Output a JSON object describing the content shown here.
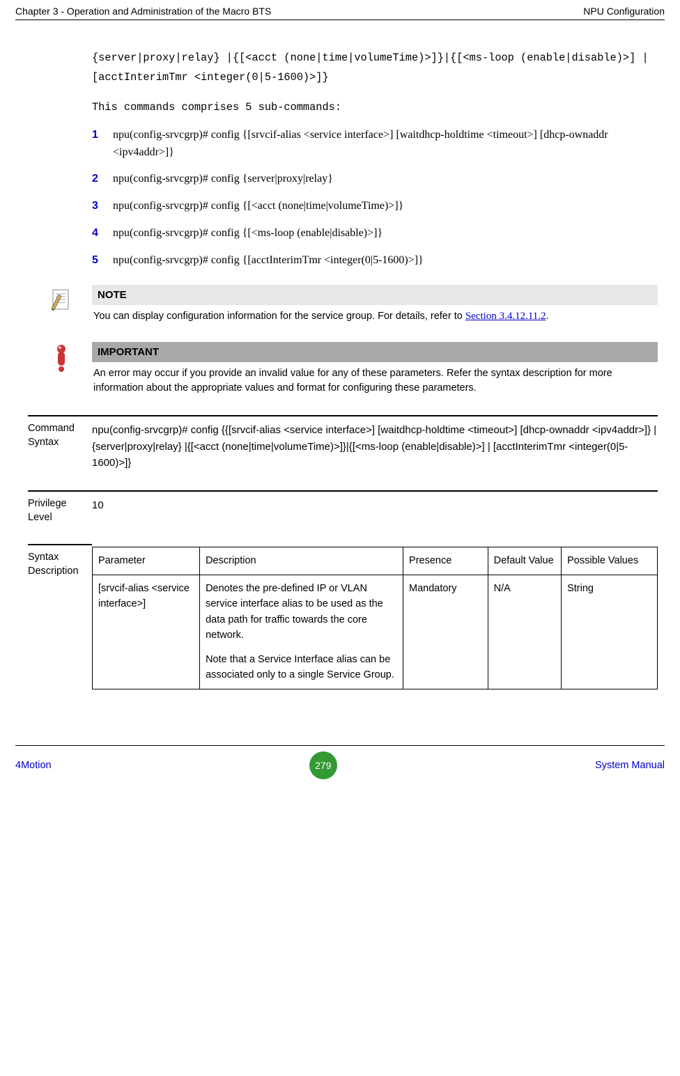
{
  "header": {
    "left": "Chapter 3 - Operation and Administration of the Macro BTS",
    "right": "NPU Configuration"
  },
  "mono1": "{server|proxy|relay} |{[<acct (none|time|volumeTime)>]}|{[<ms-loop (enable|disable)>] | [acctInterimTmr <integer(0|5-1600)>]}",
  "mono2": "This commands comprises 5 sub-commands:",
  "list": [
    {
      "n": "1",
      "t": "npu(config-srvcgrp)# config {[srvcif-alias <service interface>] [waitdhcp-holdtime <timeout>] [dhcp-ownaddr <ipv4addr>]}"
    },
    {
      "n": "2",
      "t": "npu(config-srvcgrp)# config {server|proxy|relay}"
    },
    {
      "n": "3",
      "t": "npu(config-srvcgrp)# config {[<acct (none|time|volumeTime)>]}"
    },
    {
      "n": "4",
      "t": "npu(config-srvcgrp)# config {[<ms-loop (enable|disable)>]}"
    },
    {
      "n": "5",
      "t": "npu(config-srvcgrp)# config {[acctInterimTmr <integer(0|5-1600)>]}"
    }
  ],
  "note": {
    "label": "NOTE",
    "text": "You can display configuration information for the service group. For details, refer to ",
    "link": "Section 3.4.12.11.2"
  },
  "important": {
    "label": "IMPORTANT",
    "text": "An error may occur if you provide an invalid value for any of these parameters. Refer the syntax description for more information about the appropriate values and format for configuring these parameters."
  },
  "command_syntax": {
    "label": "Command Syntax",
    "text": "npu(config-srvcgrp)# config {{[srvcif-alias <service interface>] [waitdhcp-holdtime <timeout>] [dhcp-ownaddr <ipv4addr>]} | {server|proxy|relay} |{[<acct (none|time|volumeTime)>]}|{[<ms-loop (enable|disable)>] | [acctInterimTmr <integer(0|5-1600)>]}"
  },
  "privilege": {
    "label": "Privilege Level",
    "value": "10"
  },
  "syntax_desc": {
    "label": "Syntax Description",
    "headers": [
      "Parameter",
      "Description",
      "Presence",
      "Default Value",
      "Possible Values"
    ],
    "row": {
      "param": "[srvcif-alias <service interface>]",
      "desc1": "Denotes the pre-defined IP or VLAN service interface alias to be used as the data path for traffic towards the core network.",
      "desc2": "Note that a Service Interface alias can be associated only to a single Service Group.",
      "presence": "Mandatory",
      "default": "N/A",
      "possible": "String"
    }
  },
  "footer": {
    "left": "4Motion",
    "page": "279",
    "right": "System Manual"
  }
}
